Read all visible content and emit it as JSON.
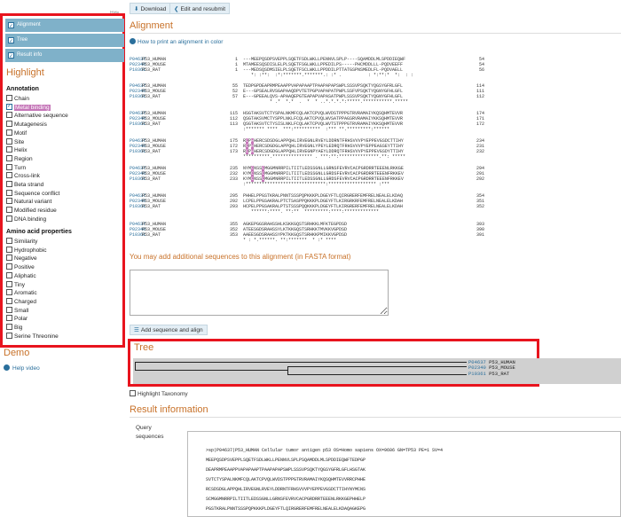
{
  "left": {
    "hide_label": "Hide",
    "view_tabs": [
      "Alignment",
      "Tree",
      "Result info"
    ],
    "highlight_title": "Highlight",
    "annotation_title": "Annotation",
    "annotation_options": [
      {
        "label": "Chain",
        "checked": false
      },
      {
        "label": "Metal binding",
        "checked": true
      },
      {
        "label": "Alternative sequence",
        "checked": false
      },
      {
        "label": "Mutagenesis",
        "checked": false
      },
      {
        "label": "Motif",
        "checked": false
      },
      {
        "label": "Site",
        "checked": false
      },
      {
        "label": "Helix",
        "checked": false
      },
      {
        "label": "Region",
        "checked": false
      },
      {
        "label": "Turn",
        "checked": false
      },
      {
        "label": "Cross-link",
        "checked": false
      },
      {
        "label": "Beta strand",
        "checked": false
      },
      {
        "label": "Sequence conflict",
        "checked": false
      },
      {
        "label": "Natural variant",
        "checked": false
      },
      {
        "label": "Modified residue",
        "checked": false
      },
      {
        "label": "DNA binding",
        "checked": false
      }
    ],
    "aa_title": "Amino acid properties",
    "aa_options": [
      "Similarity",
      "Hydrophobic",
      "Negative",
      "Positive",
      "Aliphatic",
      "Tiny",
      "Aromatic",
      "Charged",
      "Small",
      "Polar",
      "Big",
      "Serine Threonine"
    ],
    "demo_title": "Demo",
    "help_video": "Help video"
  },
  "toolbar": {
    "download": "Download",
    "edit_resubmit": "Edit and resubmit"
  },
  "alignment": {
    "title": "Alignment",
    "print_link": "How to print an alignment in color",
    "blocks": [
      {
        "rows": [
          {
            "acc": "P04637",
            "name": "P53_HUMAN",
            "start": "1",
            "seq": "---MEEPQSDPSVEPPLSQETFSDLWKLLPENNVLSPLP----SQAMDDLMLSPDDIEQWF",
            "end": "54"
          },
          {
            "acc": "P02340",
            "name": "P53_MOUSE",
            "start": "1",
            "seq": "MTAMEESQSDISLELPLSQETFSGLWKLLPPEDILPS-----PHCMDDLLL-PQDVEEFF",
            "end": "54"
          },
          {
            "acc": "P10361",
            "name": "P53_RAT",
            "start": "1",
            "seq": "---MEDSQSDMSIELPLSQETFSCLWKLLPPDDILPTTATGSPNSMEDLFL-PQDVAELL",
            "end": "56"
          }
        ],
        "cons": "   *: :**:  :*:*******.*******.: :* .          : *:**:*  *:  : :"
      },
      {
        "rows": [
          {
            "acc": "P04637",
            "name": "P53_HUMAN",
            "start": "55",
            "seq": "TEDPGPDEAPRMPEAAPPVAPAPAAPTPAAPAPAPSWPLSSSVPSQKTYQGSYGFRLGFL",
            "end": "114"
          },
          {
            "acc": "P02340",
            "name": "P53_MOUSE",
            "start": "52",
            "seq": "E---GPSEALRVSGAPAAQDPVTETPGPVAPAPATPWPLSSFVPSQKTYQGNYGFHLGFL",
            "end": "111"
          },
          {
            "acc": "P10361",
            "name": "P53_RAT",
            "start": "57",
            "seq": "E---GPEEALQVS-APAAQEPGTEAPAPVAPASATPWPLSSSVPSQKTYQGNYGFHLGFL",
            "end": "112"
          }
        ],
        "cons": "          * .*  *.*  .  *  * ..*.*.*.*:*****.***********.*****"
      },
      {
        "rows": [
          {
            "acc": "P04637",
            "name": "P53_HUMAN",
            "start": "115",
            "seq": "HSGTAKSVTCTYSPALNKMFCQLAKTCPVQLWVDSTPPPGTRVRAMAIYKQSQHMTEVVR",
            "end": "174"
          },
          {
            "acc": "P02340",
            "name": "P53_MOUSE",
            "start": "112",
            "seq": "QSGTAKSVMCTYSPPLNKLFCQLAKTCPVQLWVSATPPAGSRVRAMAIYKKSQHMTEVVR",
            "end": "171"
          },
          {
            "acc": "P10361",
            "name": "P53_RAT",
            "start": "113",
            "seq": "QSGTAKSVTCTYSISLNKLFCQLAKTCPVQLWVTSTPPPGTRVRAMAIYKKSQHMTEVVR",
            "end": "172"
          }
        ],
        "cons": ":******* ****  ***:**********  :*** **.*********:******"
      },
      {
        "rows": [
          {
            "acc": "P04637",
            "name": "P53_HUMAN",
            "start": "175",
            "seq": "RCPHHERCSDSDGLAPPQHLIRVEGNLRVEYLDDRNTFRHSVVVPYEPPEVGSDCTTIHY",
            "end": "234"
          },
          {
            "acc": "P02340",
            "name": "P53_MOUSE",
            "start": "172",
            "seq": "RCPHHERCSDGDGLAPPQHLIRVEGNLYPEYLEDRQTFRHSVVVPYEPPEAGSEYTTIHY",
            "end": "231"
          },
          {
            "acc": "P10361",
            "name": "P53_RAT",
            "start": "173",
            "seq": "RCPHHERCSDGDGLAPPQHLIRVEGNPYAEYLDDRQTFRHSVVVPYEPPEVGSDYTTIHY",
            "end": "232"
          }
        ],
        "cons": "**********.*************** . ***:**:***************.**: *****"
      },
      {
        "rows": [
          {
            "acc": "P04637",
            "name": "P53_HUMAN",
            "start": "235",
            "seq": "NYMCNSSCMGGMNRRPILTIITLEDSSGNLLGRNSFEVRVCACPGRDRRTEEENLRKKGE",
            "end": "294"
          },
          {
            "acc": "P02340",
            "name": "P53_MOUSE",
            "start": "232",
            "seq": "KYMCNSSCMGGMNRRPILTIITLEDSSGNLLGRDSFEVRVCACPGRDRRTEEENFRKKEV",
            "end": "291"
          },
          {
            "acc": "P10361",
            "name": "P53_RAT",
            "start": "233",
            "seq": "KYMCNSSCMGGMNRRPILTIITLEDSSGNLLGRDSFEVRVCACPGRDRRTEEENFRKKEV",
            "end": "292"
          }
        ],
        "cons": ":******************************:****************** :***"
      },
      {
        "rows": [
          {
            "acc": "P04637",
            "name": "P53_HUMAN",
            "start": "295",
            "seq": "PHHELPPGSTKRALPNNTSSSPQPKKKPLDGEYFTLQIRGRERFEMFRELNEALELKDAQ",
            "end": "354"
          },
          {
            "acc": "P02340",
            "name": "P53_MOUSE",
            "start": "292",
            "seq": "LCPELPPGSAKRALPTCTSASPPQKKKPLDGEYFTLKIRGRKRFEMFRELNEALELKDAH",
            "end": "351"
          },
          {
            "acc": "P10361",
            "name": "P53_RAT",
            "start": "293",
            "seq": "HCPELPPGSAKRALPTSTSSSPQQKKKPLDGEYFTLKIRGRERFEMFRELNEALELKDAH",
            "end": "352"
          }
        ],
        "cons": "   ******:****. **:**  *********:****:*************"
      },
      {
        "rows": [
          {
            "acc": "P04637",
            "name": "P53_HUMAN",
            "start": "355",
            "seq": "AGKEPGGSRAHSSHLKSKKGQSTSRHKKLMFKTEGPDSD",
            "end": "393"
          },
          {
            "acc": "P02340",
            "name": "P53_MOUSE",
            "start": "352",
            "seq": "ATEESGDSRAHSSYLKTKKGQSTSRHKKTMVKKVGPDSD",
            "end": "390"
          },
          {
            "acc": "P10361",
            "name": "P53_RAT",
            "start": "353",
            "seq": "AAEESGDSRAHSSYPKTKKGQSTSRHKKPMIKKVGPDSD",
            "end": "391"
          }
        ],
        "cons": "* : *.******. **:*******  * :* ****"
      }
    ]
  },
  "fasta": {
    "prompt": "You may add additional sequences to this alignment (in FASTA format)",
    "add_button": "Add sequence and align"
  },
  "tree": {
    "title": "Tree",
    "leaves": [
      {
        "acc": "P04637",
        "name": "P53_HUMAN"
      },
      {
        "acc": "P02340",
        "name": "P53_MOUSE"
      },
      {
        "acc": "P10361",
        "name": "P53_RAT"
      }
    ],
    "highlight_taxonomy": "Highlight Taxonomy"
  },
  "result": {
    "title": "Result information",
    "query_label": "Query sequences",
    "lines": [
      ">sp|P04637|P53_HUMAN Cellular tumor antigen p53 OS=Homo sapiens OX=9606 GN=TP53 PE=1 SV=4",
      "MEEPQSDPSVEPPLSQETFSDLWKLLPENNVLSPLPSQAMDDLMLSPDDIEQWFTEDPGP",
      "DEAPRMPEAAPPVAPAPAAPTPAAPAPAPSWPLSSSVPSQKTYQGSYGFRLGFLHSGTAK",
      "SVTCTYSPALNKMFCQLAKTCPVQLWVDSTPPPGTRVRAMAIYKQSQHMTEVVRRCPHHE",
      "RCSDSDGLAPPQHLIRVEGNLRVEYLDDRNTFRHSVVVPYEPPEVGSDCTTIHYNYMCNS",
      "SCMGGMNRRPILTIITLEDSSGNLLGRNSFEVRVCACPGRDRRTEEENLRKKGEPHHELP",
      "PGSTKRALPNNTSSSPQPKKKPLDGEYFTLQIRGRERFEMFRELNEALELKDAQAGKEPG",
      "GSRAHSSHLKSKKGQSTSRHKKLMFKTEGPDSD"
    ]
  }
}
